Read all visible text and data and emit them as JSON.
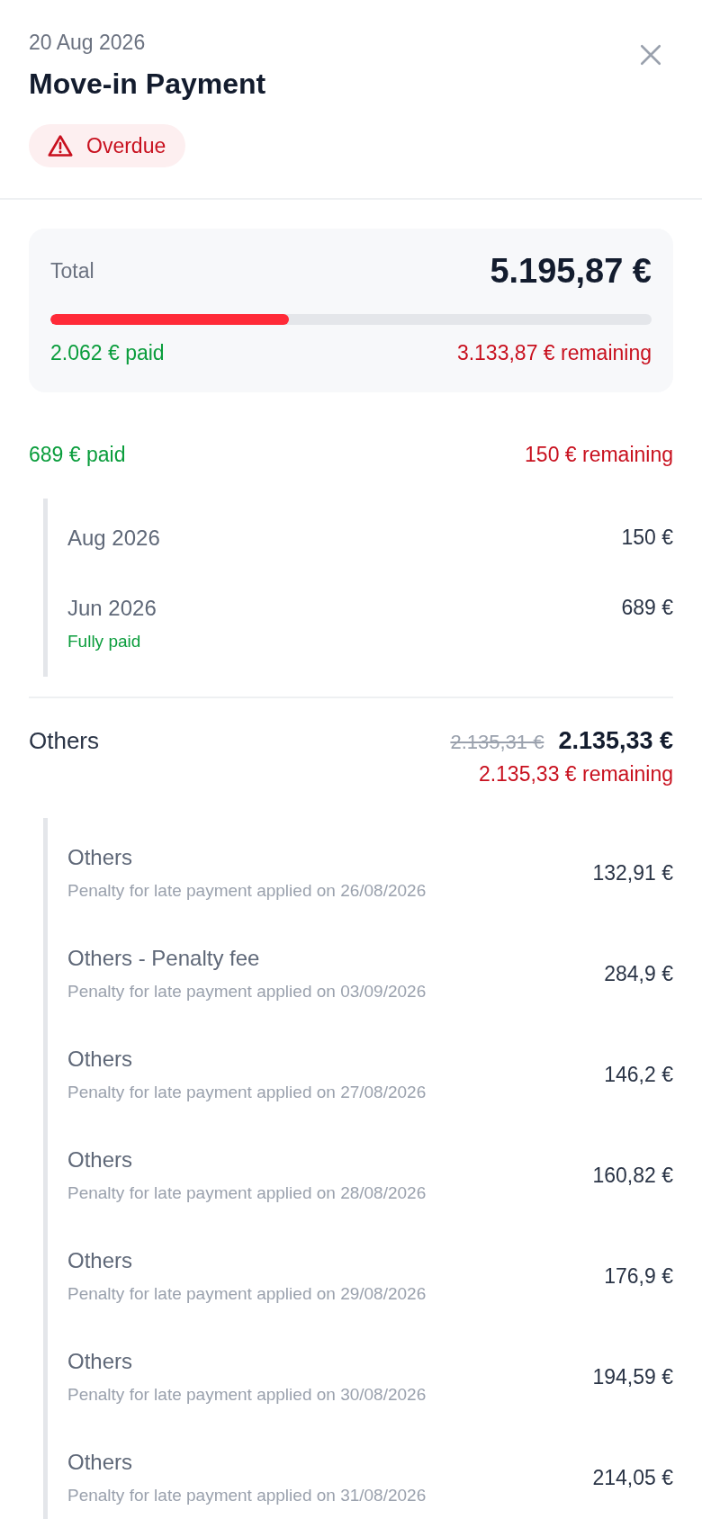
{
  "header": {
    "date": "20 Aug 2026",
    "title": "Move-in Payment",
    "status": {
      "kind": "overdue",
      "label": "Overdue"
    }
  },
  "total": {
    "label": "Total",
    "amount": "5.195,87 €",
    "level": 0.397,
    "paid": "2.062 € paid",
    "remaining": "3.133,87 € remaining"
  },
  "sections": [
    {
      "paid": "689 € paid",
      "remaining": "150 € remaining",
      "entries": [
        {
          "label": "Aug 2026",
          "amount": "150 €"
        },
        {
          "label": "Jun 2026",
          "amount": "689 €",
          "note": "Fully paid"
        }
      ]
    },
    {
      "title": "Others",
      "original_amount": "2.135,31 €",
      "amount": "2.135,33 €",
      "remaining": "2.135,33 € remaining",
      "entries": [
        {
          "label": "Others",
          "amount": "132,91 €",
          "detail": "Penalty for late payment applied on 26/08/2026"
        },
        {
          "label": "Others - Penalty fee",
          "amount": "284,9 €",
          "detail": "Penalty for late payment applied on 03/09/2026"
        },
        {
          "label": "Others",
          "amount": "146,2 €",
          "detail": "Penalty for late payment applied on 27/08/2026"
        },
        {
          "label": "Others",
          "amount": "160,82 €",
          "detail": "Penalty for late payment applied on 28/08/2026"
        },
        {
          "label": "Others",
          "amount": "176,9 €",
          "detail": "Penalty for late payment applied on 29/08/2026"
        },
        {
          "label": "Others",
          "amount": "194,59 €",
          "detail": "Penalty for late payment applied on 30/08/2026"
        },
        {
          "label": "Others",
          "amount": "214,05 €",
          "detail": "Penalty for late payment applied on 31/08/2026"
        }
      ]
    }
  ]
}
